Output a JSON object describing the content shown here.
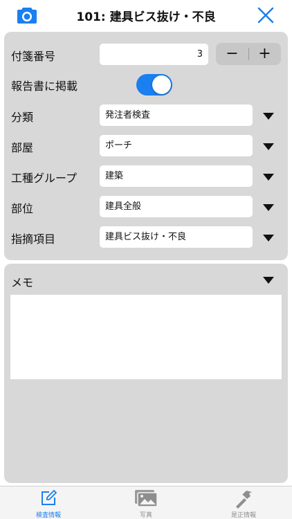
{
  "header": {
    "title": "101: 建具ビス抜け・不良",
    "camera_icon": "camera-icon",
    "close_icon": "close-icon",
    "accent_color": "#1a7ff0"
  },
  "form": {
    "sticky_number": {
      "label": "付箋番号",
      "value": "3",
      "minus": "−",
      "plus": "+"
    },
    "report_include": {
      "label": "報告書に掲載",
      "enabled": true
    },
    "category": {
      "label": "分類",
      "value": "発注者検査"
    },
    "room": {
      "label": "部屋",
      "value": "ポーチ"
    },
    "trade_group": {
      "label": "工種グループ",
      "value": "建築"
    },
    "part": {
      "label": "部位",
      "value": "建具全般"
    },
    "issue": {
      "label": "指摘項目",
      "value": "建具ビス抜け・不良"
    }
  },
  "memo": {
    "label": "メモ",
    "value": ""
  },
  "tabbar": {
    "tabs": [
      {
        "label": "検査情報",
        "icon": "edit-icon",
        "active": true
      },
      {
        "label": "写真",
        "icon": "photos-icon",
        "active": false
      },
      {
        "label": "是正情報",
        "icon": "hammer-icon",
        "active": false
      }
    ]
  }
}
